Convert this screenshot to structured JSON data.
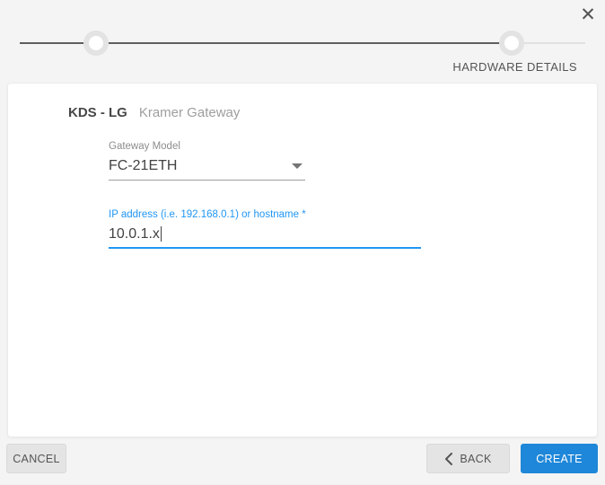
{
  "dialog": {
    "close_label": "✕"
  },
  "stepper": {
    "step_label": "HARDWARE DETAILS"
  },
  "card": {
    "title": "KDS - LG",
    "subtitle": "Kramer Gateway",
    "gateway_model": {
      "label": "Gateway Model",
      "value": "FC-21ETH"
    },
    "ip_address": {
      "label": "IP address (i.e. 192.168.0.1) or hostname *",
      "value": "10.0.1.x"
    }
  },
  "footer": {
    "cancel": "CANCEL",
    "back": "BACK",
    "create": "CREATE"
  },
  "colors": {
    "accent_blue": "#2196f3",
    "create_button_blue": "#1e87d9",
    "stepper_line_dark": "#5e5e5e",
    "stepper_ring_gray": "#e3e3e3",
    "page_background": "#f4f4f4"
  }
}
